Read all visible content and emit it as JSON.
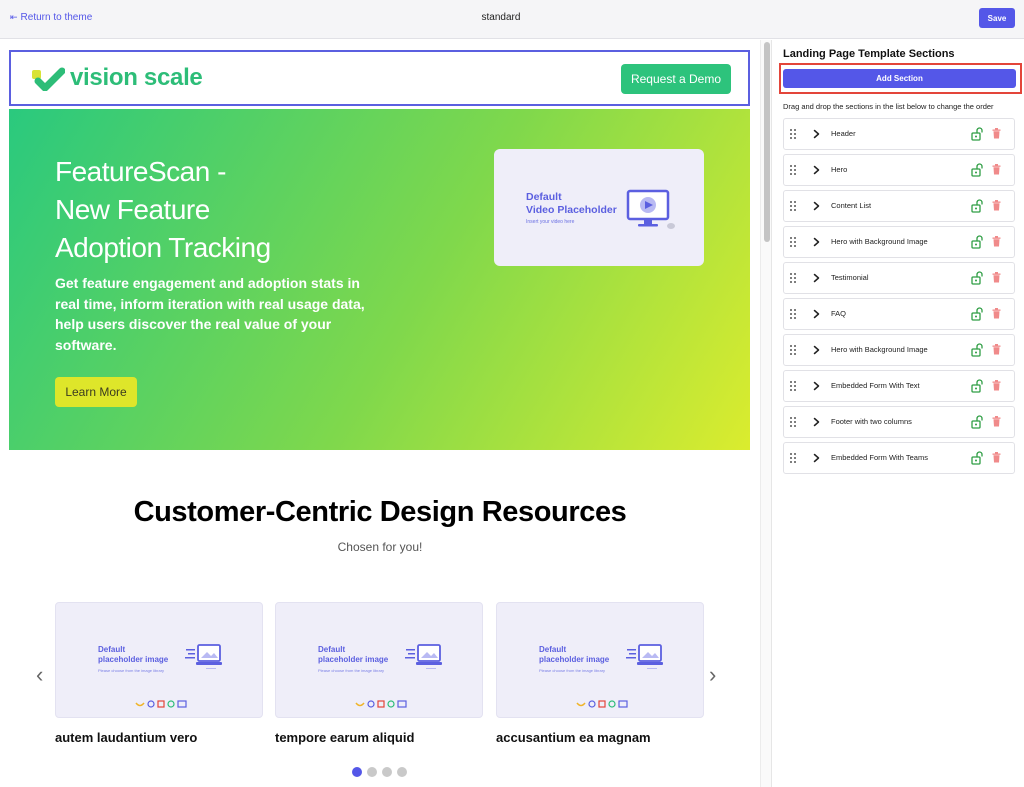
{
  "topbar": {
    "return_label": "Return to theme",
    "title": "standard",
    "save_label": "Save"
  },
  "site": {
    "logo_text": "vision scale",
    "demo_label": "Request a Demo",
    "hero_title_lines": [
      "FeatureScan -",
      "New Feature",
      "Adoption Tracking"
    ],
    "hero_description": "Get feature engagement and adoption stats in real time, inform iteration with real usage data, help users discover the real value of your software.",
    "learn_label": "Learn More",
    "video_title_lines": [
      "Default",
      "Video Placeholder"
    ],
    "video_subtitle": "Insert your video here",
    "resources_heading": "Customer-Centric Design Resources",
    "resources_subheading": "Chosen for you!",
    "card_placeholder_lines": [
      "Default",
      "placeholder image"
    ],
    "card_placeholder_hint": "Please choose from the image library",
    "cards": [
      {
        "caption": "autem laudantium vero"
      },
      {
        "caption": "tempore earum aliquid"
      },
      {
        "caption": "accusantium ea magnam"
      }
    ],
    "pager_count": 4,
    "pager_active": 0
  },
  "panel": {
    "title": "Landing Page Template Sections",
    "add_label": "Add Section",
    "hint": "Drag and drop the sections in the list below to change the order",
    "sections": [
      {
        "label": "Header"
      },
      {
        "label": "Hero"
      },
      {
        "label": "Content List"
      },
      {
        "label": "Hero with Background Image"
      },
      {
        "label": "Testimonial"
      },
      {
        "label": "FAQ"
      },
      {
        "label": "Hero with Background Image"
      },
      {
        "label": "Embedded Form With Text"
      },
      {
        "label": "Footer with two columns"
      },
      {
        "label": "Embedded Form With Teams"
      }
    ]
  },
  "colors": {
    "accent": "#5457e8",
    "brand_green": "#2dbd78",
    "highlight_red": "#e3453a",
    "lock_green": "#2f9e44",
    "trash_red": "#f08a8a"
  },
  "icons": {
    "return": "arrow-left-bar-icon",
    "drag": "drag-handle-icon",
    "expand": "chevron-right-icon",
    "lock": "lock-open-icon",
    "delete": "trash-icon",
    "prev": "chevron-left-icon",
    "next": "chevron-right-icon"
  }
}
